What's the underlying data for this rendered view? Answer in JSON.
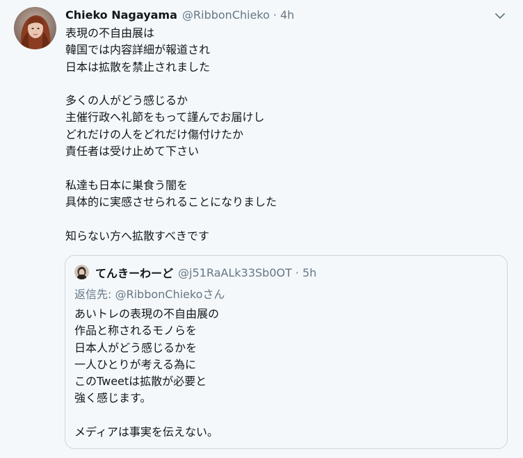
{
  "tweet": {
    "author": {
      "name": "Chieko Nagayama",
      "handle": "@RibbonChieko"
    },
    "separator": "·",
    "time": "4h",
    "lines": [
      "表現の不自由展は",
      "韓国では内容詳細が報道され",
      "日本は拡散を禁止されました",
      "",
      "多くの人がどう感じるか",
      "主催行政へ礼節をもって謹んでお届けし",
      "どれだけの人をどれだけ傷付けたか",
      "責任者は受け止めて下さい",
      "",
      "私達も日本に巣食う闇を",
      "具体的に実感させられることになりました",
      "",
      "知らない方へ拡散すべきです"
    ]
  },
  "quoted": {
    "author": {
      "name": "てんきーわーど",
      "handle": "@j51RaALk33Sb0OT"
    },
    "separator": "·",
    "time": "5h",
    "reply_to": "返信先: @RibbonChiekoさん",
    "lines": [
      "あいトレの表現の不自由展の",
      "作品と称されるモノらを",
      "日本人がどう感じるかを",
      "一人ひとりが考える為に",
      "このTweetは拡散が必要と",
      "強く感じます。",
      "",
      "メディアは事実を伝えない。"
    ]
  },
  "icons": {
    "menu": "chevron-down-icon"
  },
  "colors": {
    "background": "#f5f8fa",
    "text": "#14171a",
    "secondary": "#657786",
    "border": "#ccd6dd"
  }
}
